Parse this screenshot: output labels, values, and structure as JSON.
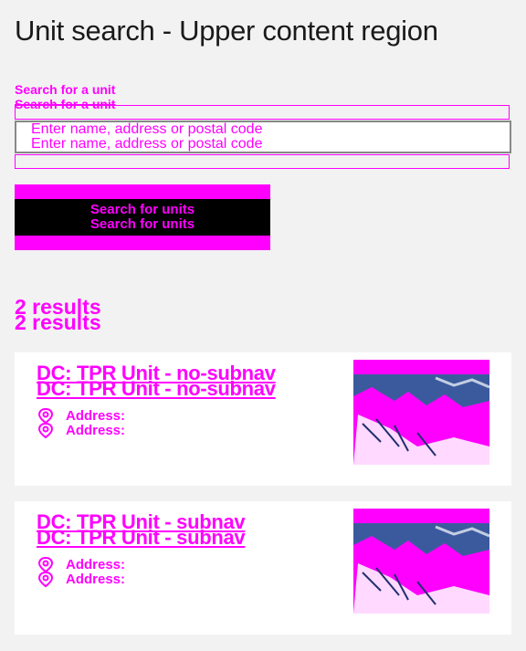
{
  "page": {
    "title": "Unit search - Upper content region"
  },
  "search": {
    "label": "Search for a unit",
    "placeholder": "Enter name, address or postal code",
    "button_label": "Search for units"
  },
  "results": {
    "count_label": "2 results",
    "items": [
      {
        "title": "DC: TPR Unit - no-subnav",
        "address_label": "Address:"
      },
      {
        "title": "DC: TPR Unit - subnav",
        "address_label": "Address:"
      }
    ]
  },
  "colors": {
    "highlight": "#ff00ff",
    "button_bg": "#000000",
    "page_bg": "#f2f2f2"
  },
  "icons": {
    "address": "location-pin-icon"
  }
}
